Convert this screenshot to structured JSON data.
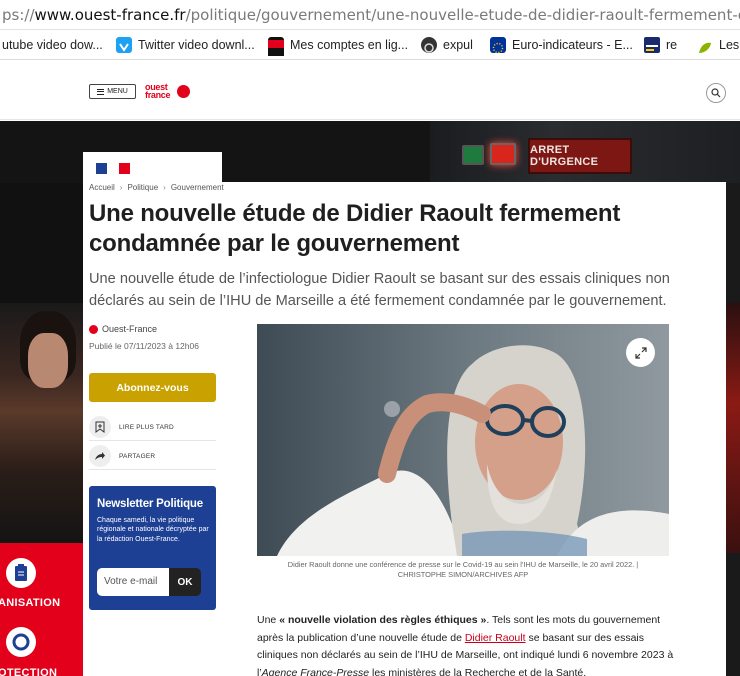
{
  "browser": {
    "url_prefix": "ps://",
    "url_domain": "www.ouest-france.fr",
    "url_path": "/politique/gouvernement/une-nouvelle-etude-de-didier-raoult-fermement-condamnee-par-le-g"
  },
  "bookmarks": [
    {
      "label": "utube video dow...",
      "icon": "youtube-icon",
      "color": "#e62117"
    },
    {
      "label": "Twitter video downl...",
      "icon": "twitter-downloader-icon",
      "color": "#1da1f2"
    },
    {
      "label": "Mes comptes en lig...",
      "icon": "bank-icon",
      "color": "#e2001a"
    },
    {
      "label": "expul",
      "icon": "expul-icon",
      "color": "#333333"
    },
    {
      "label": "Euro-indicateurs - E...",
      "icon": "eu-flag-icon",
      "color": "#003399"
    },
    {
      "label": "re",
      "icon": "franceinfo-icon",
      "color": "#1a2a6c"
    },
    {
      "label": "Les",
      "icon": "leaf-icon",
      "color": "#8ab400"
    }
  ],
  "header": {
    "menu_label": "MENU",
    "logo_line1": "ouest",
    "logo_line2": "france"
  },
  "hero": {
    "emergency_label": "ARRET D'URGENCE"
  },
  "left_ad": {
    "label1": "ANISATION",
    "label2": "OTECTION"
  },
  "article": {
    "breadcrumb": [
      "Accueil",
      "Politique",
      "Gouvernement"
    ],
    "headline": "Une nouvelle étude de Didier Raoult fermement condamnée par le gouvernement",
    "lede": "Une nouvelle étude de l’infectiologue Didier Raoult se basant sur des essais cliniques non déclarés au sein de l’IHU de Marseille a été fermement condamnée par le gouvernement.",
    "source": "Ouest-France",
    "published": "Publié le 07/11/2023 à 12h06",
    "subscribe_label": "Abonnez-vous",
    "read_later_label": "LIRE PLUS TARD",
    "share_label": "PARTAGER",
    "newsletter": {
      "title": "Newsletter Politique",
      "description": "Chaque samedi, la vie politique régionale et nationale décryptée par la rédaction Ouest-France.",
      "placeholder": "Votre e-mail",
      "ok_label": "OK"
    },
    "caption_line1": "Didier Raoult donne une conférence de presse sur le Covid-19 au sein l'IHU de Marseille, le 20 avril 2022. |",
    "caption_line2": "CHRISTOPHE SIMON/ARCHIVES AFP",
    "body": {
      "p1_start": "Une ",
      "p1_bold": "« nouvelle violation des règles éthiques »",
      "p1_mid": ". Tels sont les mots du gouvernement après la publication d’une nouvelle étude de ",
      "p1_link": "Didier Raoult",
      "p1_mid2": " se basant sur des essais cliniques non déclarés au sein de l’IHU de Marseille, ont indiqué lundi 6 novembre 2023 à l’",
      "p1_italic": "Agence France-Presse",
      "p1_end": " les ministères de la Recherche et de la Santé."
    }
  }
}
